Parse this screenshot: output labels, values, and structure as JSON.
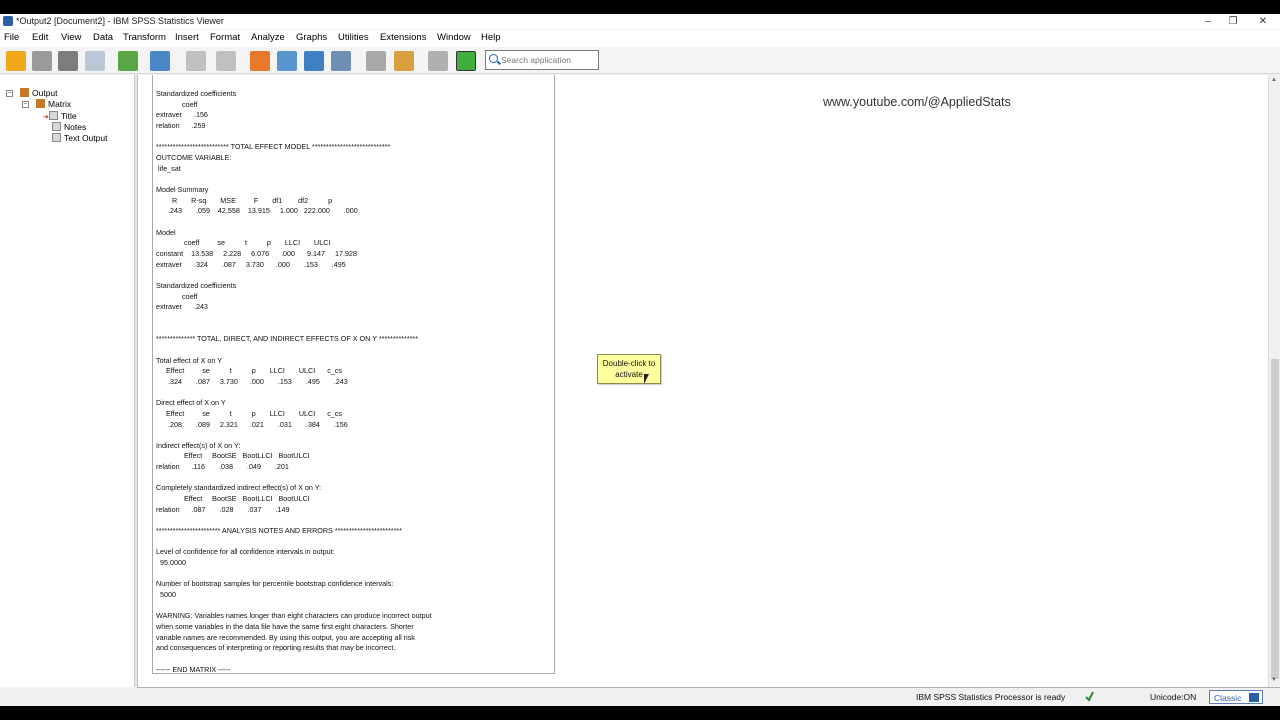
{
  "window": {
    "title": "*Output2 [Document2] - IBM SPSS Statistics Viewer"
  },
  "menu": [
    "File",
    "Edit",
    "View",
    "Data",
    "Transform",
    "Insert",
    "Format",
    "Analyze",
    "Graphs",
    "Utilities",
    "Extensions",
    "Window",
    "Help"
  ],
  "search": {
    "placeholder": "Search application"
  },
  "outline": {
    "root": "Output",
    "group": "Matrix",
    "items": [
      "Title",
      "Notes",
      "Text Output"
    ]
  },
  "watermark": "www.youtube.com/@AppliedStats",
  "tooltip": {
    "line1": "Double-click to",
    "line2": "activate"
  },
  "output_lines": [
    "Standardized coefficients",
    "             coeff",
    "extraver      .156",
    "relation      .259",
    "",
    "************************** TOTAL EFFECT MODEL ****************************",
    "OUTCOME VARIABLE:",
    " life_sat",
    "",
    "Model Summary",
    "        R       R-sq       MSE         F       df1        df2          p",
    "      .243       .059    42.558    13.915     1.000   222.000       .000",
    "",
    "Model",
    "              coeff         se          t          p       LLCI       ULCI",
    "constant    13.538     2.228     6.076      .000      9.147     17.928",
    "extraver      .324       .087     3.730      .000       .153       .495",
    "",
    "Standardized coefficients",
    "             coeff",
    "extraver      .243",
    "",
    "",
    "************** TOTAL, DIRECT, AND INDIRECT EFFECTS OF X ON Y **************",
    "",
    "Total effect of X on Y",
    "     Effect         se          t          p       LLCI       ULCI      c_cs",
    "      .324       .087     3.730      .000       .153       .495       .243",
    "",
    "Direct effect of X on Y",
    "     Effect         se          t          p       LLCI       ULCI      c_cs",
    "      .208       .089     2.321      .021       .031       .384       .156",
    "",
    "Indirect effect(s) of X on Y:",
    "              Effect     BootSE   BootLLCI   BootULCI",
    "relation      .116       .038       .049       .201",
    "",
    "Completely standardized indirect effect(s) of X on Y:",
    "              Effect     BootSE   BootLLCI   BootULCI",
    "relation      .087       .028       .037       .149",
    "",
    "*********************** ANALYSIS NOTES AND ERRORS ************************",
    "",
    "Level of confidence for all confidence intervals in output:",
    "  95.0000",
    "",
    "Number of bootstrap samples for percentile bootstrap confidence intervals:",
    "  5000",
    "",
    "WARNING: Variables names longer than eight characters can produce incorrect output",
    "when some variables in the data file have the same first eight characters. Shorter",
    "variable names are recommended. By using this output, you are accepting all risk",
    "and consequences of interpreting or reporting results that may be incorrect.",
    "",
    "------ END MATRIX -----"
  ],
  "status": {
    "processor": "IBM SPSS Statistics Processor is ready",
    "unicode": "Unicode:ON",
    "mode": "Classic"
  },
  "colors": {
    "accent": "#2b5fa6",
    "tooltip_bg": "#ffff9d",
    "check": "#2e8b3a"
  }
}
